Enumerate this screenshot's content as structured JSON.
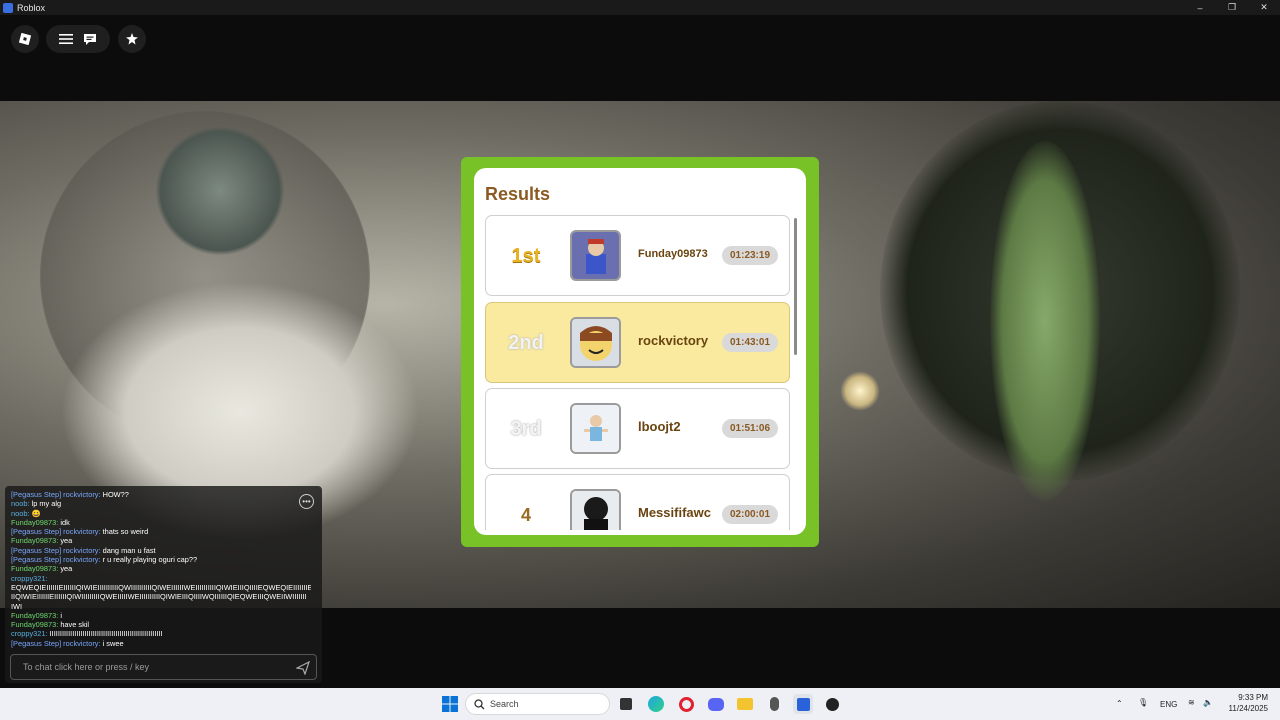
{
  "window": {
    "title": "Roblox",
    "controls": [
      "–",
      "❐",
      "✕"
    ]
  },
  "results": {
    "title": "Results",
    "rows": [
      {
        "place": "1st",
        "name": "Funday09873",
        "time": "01:23:19"
      },
      {
        "place": "2nd",
        "name": "rockvictory",
        "time": "01:43:01"
      },
      {
        "place": "3rd",
        "name": "lboojt2",
        "time": "01:51:06"
      },
      {
        "place": "4",
        "name": "Messififawc",
        "time": "02:00:01"
      }
    ]
  },
  "chat": {
    "lines": [
      {
        "user": "[Pegasus Step] rockvictory:",
        "msg": " HOW??",
        "cls": "u-blue"
      },
      {
        "user": "noob:",
        "msg": " lp my alg",
        "cls": "u-teal"
      },
      {
        "user": "noob:",
        "msg": " 😀",
        "cls": "u-teal"
      },
      {
        "user": "Funday09873:",
        "msg": " idk",
        "cls": "u-green"
      },
      {
        "user": "[Pegasus Step] rockvictory:",
        "msg": " thats so weird",
        "cls": "u-blue"
      },
      {
        "user": "Funday09873:",
        "msg": " yea",
        "cls": "u-green"
      },
      {
        "user": "[Pegasus Step] rockvictory:",
        "msg": " dang man u fast",
        "cls": "u-blue"
      },
      {
        "user": "[Pegasus Step] rockvictory:",
        "msg": " r u really playing oguri cap??",
        "cls": "u-blue"
      },
      {
        "user": "Funday09873:",
        "msg": " yea",
        "cls": "u-green"
      },
      {
        "user": "croppy321:",
        "msg": "",
        "cls": "u-teal"
      },
      {
        "user": "",
        "msg": "EQWEQIEIIIIIIEIIIIIIQIWIEIIIIIIIIIIQWIIIIIIIIIIQIWEIIIIIIWEIIIIIIIIIIQIWIEIIIQIIIIEQWEQIEIIIIIIIE",
        "cls": ""
      },
      {
        "user": "",
        "msg": "IIQIWIEIIIIIIEIIIIIIQIWIIIIIIIIIQWEIIIIIWEIIIIIIIIIIQIWIEIIIQIIIIWQIIIIIIQIEQWEIIIQWEIIWIIIIIII",
        "cls": ""
      },
      {
        "user": "",
        "msg": "IWI",
        "cls": ""
      },
      {
        "user": "Funday09873:",
        "msg": " i",
        "cls": "u-green"
      },
      {
        "user": "Funday09873:",
        "msg": " have skil",
        "cls": "u-green"
      },
      {
        "user": "croppy321:",
        "msg": " IIIIIIIIIIIIIIIIIIIIIIIIIIIIIIIIIIIIIIIIIIIIIIIIIIIIIII",
        "cls": "u-teal"
      },
      {
        "user": "[Pegasus Step] rockvictory:",
        "msg": " i swee",
        "cls": "u-blue"
      }
    ],
    "input_placeholder": "To chat click here or press / key"
  },
  "taskbar": {
    "search_placeholder": "Search",
    "lang": "ENG",
    "time": "9:33 PM",
    "date": "11/24/2025"
  }
}
